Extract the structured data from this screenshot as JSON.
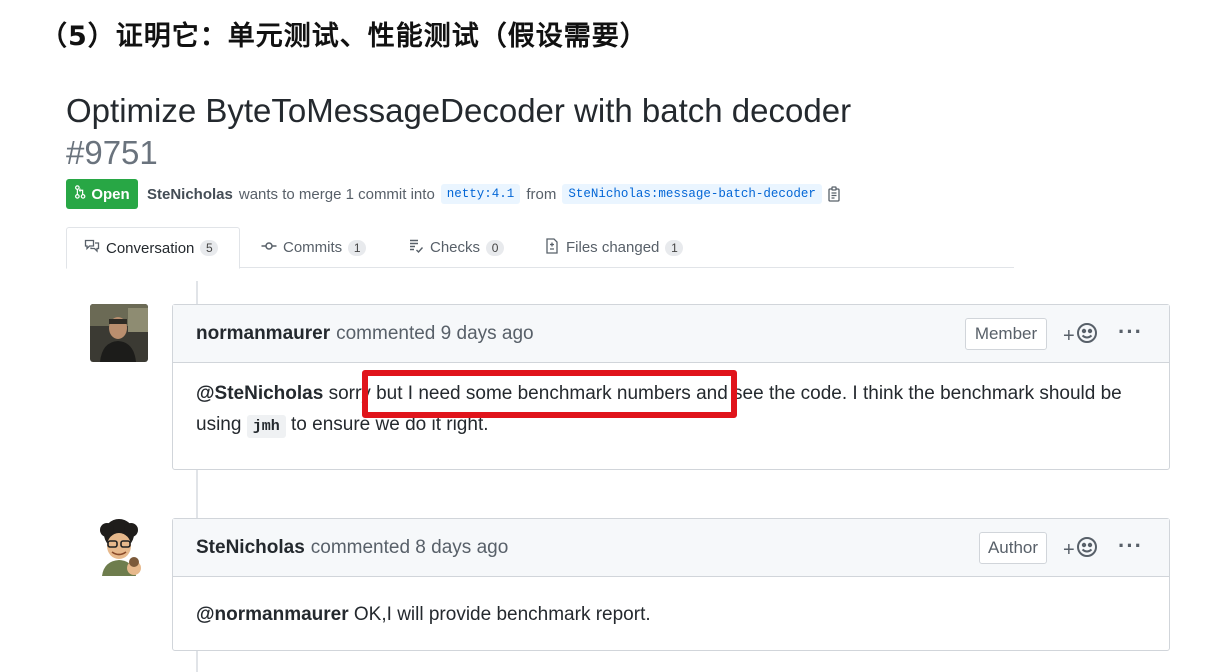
{
  "slide": {
    "heading": "（5）证明它：单元测试、性能测试（假设需要）"
  },
  "pull_request": {
    "title": "Optimize ByteToMessageDecoder with batch decoder",
    "number": "#9751",
    "state_label": "Open",
    "author": "SteNicholas",
    "merge_text": "wants to merge 1 commit into",
    "base_branch": "netty:4.1",
    "from_text": "from",
    "head_branch": "SteNicholas:message-batch-decoder"
  },
  "tabs": [
    {
      "label": "Conversation",
      "count": "5"
    },
    {
      "label": "Commits",
      "count": "1"
    },
    {
      "label": "Checks",
      "count": "0"
    },
    {
      "label": "Files changed",
      "count": "1"
    }
  ],
  "comments": [
    {
      "login": "normanmaurer",
      "meta": "commented 9 days ago",
      "role": "Member",
      "body_mention": "@SteNicholas",
      "body_part1": "sorry but I need some benchmark numbers and see the code. I think the benchmark should be using",
      "body_code": "jmh",
      "body_part2": "to ensure we do it right."
    },
    {
      "login": "SteNicholas",
      "meta": "commented 8 days ago",
      "role": "Author",
      "body_mention": "@normanmaurer",
      "body_part1": "OK,I will provide benchmark report."
    }
  ],
  "ui": {
    "reaction_plus": "+",
    "more_dots": "···"
  },
  "colors": {
    "open_green": "#28a745",
    "highlight_red": "#e0141b",
    "link_blue": "#0366d6"
  },
  "icons": {
    "state": "git-pull-request-icon",
    "copy": "clipboard-copy-icon",
    "conversation": "comment-discussion-icon",
    "commits": "git-commit-icon",
    "checks": "checklist-icon",
    "files": "file-diff-icon",
    "reaction": "smiley-icon"
  }
}
